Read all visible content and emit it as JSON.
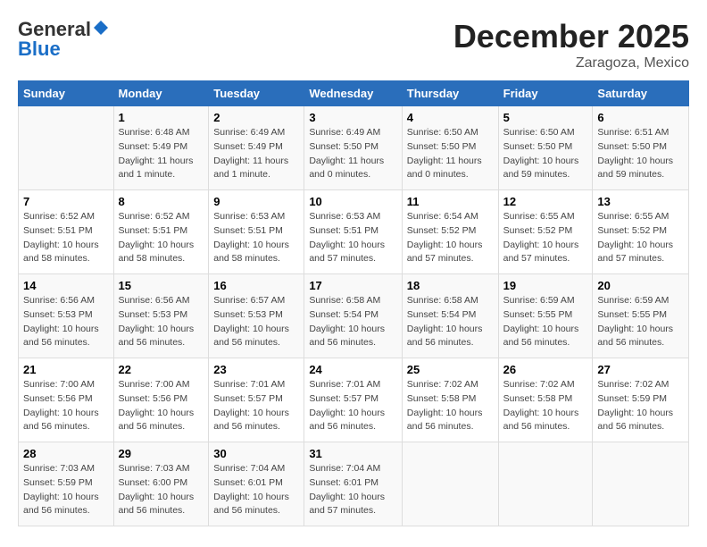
{
  "header": {
    "logo_general": "General",
    "logo_blue": "Blue",
    "month_year": "December 2025",
    "location": "Zaragoza, Mexico"
  },
  "columns": [
    "Sunday",
    "Monday",
    "Tuesday",
    "Wednesday",
    "Thursday",
    "Friday",
    "Saturday"
  ],
  "weeks": [
    [
      {
        "day": "",
        "info": ""
      },
      {
        "day": "1",
        "info": "Sunrise: 6:48 AM\nSunset: 5:49 PM\nDaylight: 11 hours\nand 1 minute."
      },
      {
        "day": "2",
        "info": "Sunrise: 6:49 AM\nSunset: 5:49 PM\nDaylight: 11 hours\nand 1 minute."
      },
      {
        "day": "3",
        "info": "Sunrise: 6:49 AM\nSunset: 5:50 PM\nDaylight: 11 hours\nand 0 minutes."
      },
      {
        "day": "4",
        "info": "Sunrise: 6:50 AM\nSunset: 5:50 PM\nDaylight: 11 hours\nand 0 minutes."
      },
      {
        "day": "5",
        "info": "Sunrise: 6:50 AM\nSunset: 5:50 PM\nDaylight: 10 hours\nand 59 minutes."
      },
      {
        "day": "6",
        "info": "Sunrise: 6:51 AM\nSunset: 5:50 PM\nDaylight: 10 hours\nand 59 minutes."
      }
    ],
    [
      {
        "day": "7",
        "info": "Sunrise: 6:52 AM\nSunset: 5:51 PM\nDaylight: 10 hours\nand 58 minutes."
      },
      {
        "day": "8",
        "info": "Sunrise: 6:52 AM\nSunset: 5:51 PM\nDaylight: 10 hours\nand 58 minutes."
      },
      {
        "day": "9",
        "info": "Sunrise: 6:53 AM\nSunset: 5:51 PM\nDaylight: 10 hours\nand 58 minutes."
      },
      {
        "day": "10",
        "info": "Sunrise: 6:53 AM\nSunset: 5:51 PM\nDaylight: 10 hours\nand 57 minutes."
      },
      {
        "day": "11",
        "info": "Sunrise: 6:54 AM\nSunset: 5:52 PM\nDaylight: 10 hours\nand 57 minutes."
      },
      {
        "day": "12",
        "info": "Sunrise: 6:55 AM\nSunset: 5:52 PM\nDaylight: 10 hours\nand 57 minutes."
      },
      {
        "day": "13",
        "info": "Sunrise: 6:55 AM\nSunset: 5:52 PM\nDaylight: 10 hours\nand 57 minutes."
      }
    ],
    [
      {
        "day": "14",
        "info": "Sunrise: 6:56 AM\nSunset: 5:53 PM\nDaylight: 10 hours\nand 56 minutes."
      },
      {
        "day": "15",
        "info": "Sunrise: 6:56 AM\nSunset: 5:53 PM\nDaylight: 10 hours\nand 56 minutes."
      },
      {
        "day": "16",
        "info": "Sunrise: 6:57 AM\nSunset: 5:53 PM\nDaylight: 10 hours\nand 56 minutes."
      },
      {
        "day": "17",
        "info": "Sunrise: 6:58 AM\nSunset: 5:54 PM\nDaylight: 10 hours\nand 56 minutes."
      },
      {
        "day": "18",
        "info": "Sunrise: 6:58 AM\nSunset: 5:54 PM\nDaylight: 10 hours\nand 56 minutes."
      },
      {
        "day": "19",
        "info": "Sunrise: 6:59 AM\nSunset: 5:55 PM\nDaylight: 10 hours\nand 56 minutes."
      },
      {
        "day": "20",
        "info": "Sunrise: 6:59 AM\nSunset: 5:55 PM\nDaylight: 10 hours\nand 56 minutes."
      }
    ],
    [
      {
        "day": "21",
        "info": "Sunrise: 7:00 AM\nSunset: 5:56 PM\nDaylight: 10 hours\nand 56 minutes."
      },
      {
        "day": "22",
        "info": "Sunrise: 7:00 AM\nSunset: 5:56 PM\nDaylight: 10 hours\nand 56 minutes."
      },
      {
        "day": "23",
        "info": "Sunrise: 7:01 AM\nSunset: 5:57 PM\nDaylight: 10 hours\nand 56 minutes."
      },
      {
        "day": "24",
        "info": "Sunrise: 7:01 AM\nSunset: 5:57 PM\nDaylight: 10 hours\nand 56 minutes."
      },
      {
        "day": "25",
        "info": "Sunrise: 7:02 AM\nSunset: 5:58 PM\nDaylight: 10 hours\nand 56 minutes."
      },
      {
        "day": "26",
        "info": "Sunrise: 7:02 AM\nSunset: 5:58 PM\nDaylight: 10 hours\nand 56 minutes."
      },
      {
        "day": "27",
        "info": "Sunrise: 7:02 AM\nSunset: 5:59 PM\nDaylight: 10 hours\nand 56 minutes."
      }
    ],
    [
      {
        "day": "28",
        "info": "Sunrise: 7:03 AM\nSunset: 5:59 PM\nDaylight: 10 hours\nand 56 minutes."
      },
      {
        "day": "29",
        "info": "Sunrise: 7:03 AM\nSunset: 6:00 PM\nDaylight: 10 hours\nand 56 minutes."
      },
      {
        "day": "30",
        "info": "Sunrise: 7:04 AM\nSunset: 6:01 PM\nDaylight: 10 hours\nand 56 minutes."
      },
      {
        "day": "31",
        "info": "Sunrise: 7:04 AM\nSunset: 6:01 PM\nDaylight: 10 hours\nand 57 minutes."
      },
      {
        "day": "",
        "info": ""
      },
      {
        "day": "",
        "info": ""
      },
      {
        "day": "",
        "info": ""
      }
    ]
  ]
}
